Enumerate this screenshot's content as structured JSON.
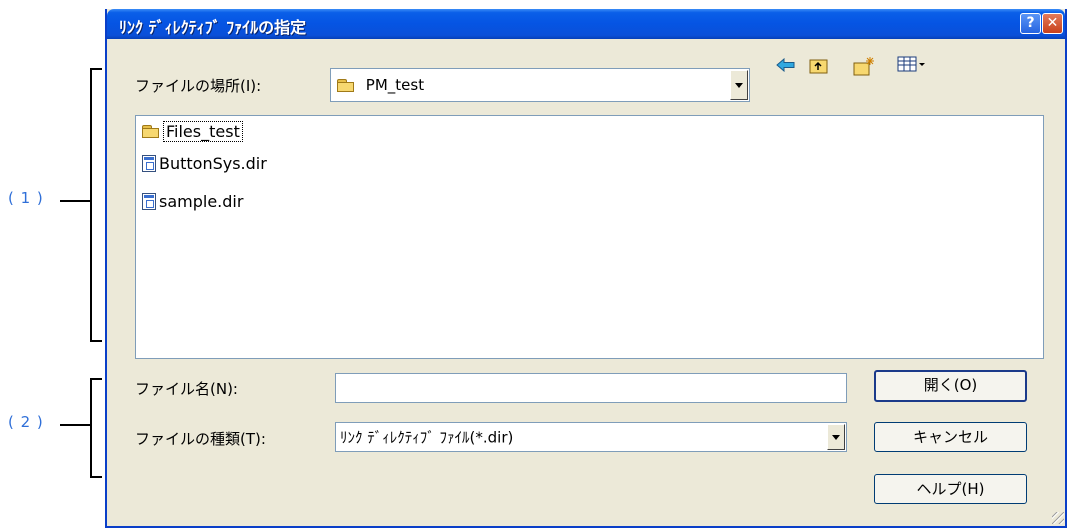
{
  "annotations": {
    "label1": "( 1 )",
    "label2": "( 2 )"
  },
  "dialog": {
    "title": "ﾘﾝｸ ﾃﾞｨﾚｸﾃｨﾌﾞ ﾌｧｲﾙの指定",
    "help_btn": "?",
    "close_btn": "✕",
    "look_in_label": "ファイルの場所(I):",
    "look_in_value": "PM_test",
    "toolbar_icons": [
      "back-icon",
      "up-folder-icon",
      "new-folder-icon",
      "view-menu-icon"
    ],
    "files": [
      {
        "name": "Files_test",
        "icon": "folder-icon"
      },
      {
        "name": "ButtonSys.dir",
        "icon": "dir-file-icon"
      },
      {
        "name": "sample.dir",
        "icon": "dir-file-icon"
      }
    ],
    "filename_label": "ファイル名(N):",
    "filename_value": "",
    "filetype_label": "ファイルの種類(T):",
    "filetype_value": "ﾘﾝｸ ﾃﾞｨﾚｸﾃｨﾌﾞ ﾌｧｲﾙ(*.dir)",
    "open_btn": "開く(O)",
    "cancel_btn": "キャンセル",
    "help_button": "ヘルプ(H)"
  }
}
